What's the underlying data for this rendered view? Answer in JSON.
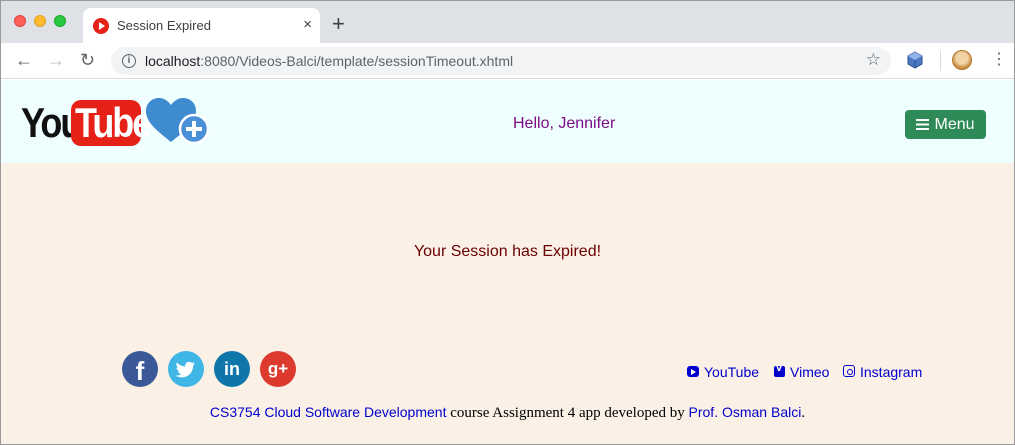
{
  "browser": {
    "tab_title": "Session Expired",
    "tab_close": "×",
    "new_tab": "+",
    "url_host": "localhost",
    "url_rest": ":8080/Videos-Balci/template/sessionTimeout.xhtml",
    "back": "←",
    "forward": "→",
    "reload": "↻",
    "star": "☆",
    "menu": "⋮",
    "info": "i"
  },
  "header": {
    "logo_you": "You",
    "logo_tube": "Tube",
    "greeting": "Hello, Jennifer",
    "menu_label": "Menu"
  },
  "main": {
    "message": "Your Session has Expired!"
  },
  "social": {
    "facebook": "f",
    "linkedin": "in",
    "googleplus": "g+"
  },
  "footer": {
    "links": [
      "YouTube",
      "Vimeo",
      "Instagram"
    ],
    "course_link": "CS3754 Cloud Software Development",
    "middle_text": " course Assignment 4 app developed by ",
    "author_link": "Prof. Osman Balci",
    "end": "."
  },
  "colors": {
    "header_bg": "#efffff",
    "page_bg": "#faf0e6",
    "menu_button": "#2e8b57",
    "greeting": "#7b0d86",
    "message": "#6b0000",
    "link": "#0000cd"
  },
  "icons": [
    "youtube-favicon",
    "info-icon",
    "star-icon",
    "extension-icon",
    "avatar",
    "heart-plus-icon",
    "hamburger-icon",
    "facebook-icon",
    "twitter-icon",
    "linkedin-icon",
    "googleplus-icon",
    "youtube-icon",
    "vimeo-icon",
    "instagram-icon"
  ]
}
